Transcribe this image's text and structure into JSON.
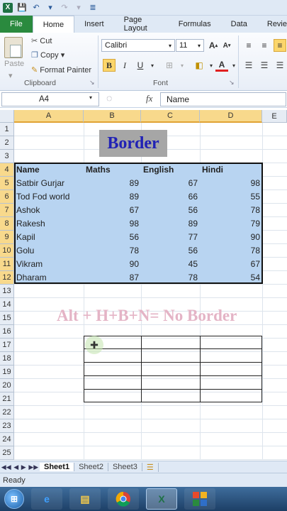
{
  "ribbon_tabs": [
    "File",
    "Home",
    "Insert",
    "Page Layout",
    "Formulas",
    "Data",
    "Revie"
  ],
  "clipboard": {
    "cut": "Cut",
    "copy": "Copy",
    "format_painter": "Format Painter",
    "paste": "Paste",
    "label": "Clipboard"
  },
  "font": {
    "name": "Calibri",
    "size": "11",
    "label": "Font"
  },
  "name_box": "A4",
  "fx_label": "fx",
  "formula_value": "Name",
  "columns": [
    "A",
    "B",
    "C",
    "D",
    "E"
  ],
  "rows": [
    "1",
    "2",
    "3",
    "4",
    "5",
    "6",
    "7",
    "8",
    "9",
    "10",
    "11",
    "12",
    "13",
    "14",
    "15",
    "16",
    "17",
    "18",
    "19",
    "20",
    "21",
    "22",
    "23",
    "24",
    "25"
  ],
  "title_text": "Border",
  "table": {
    "headers": [
      "Name",
      "Maths",
      "English",
      "Hindi"
    ],
    "rows": [
      [
        "Satbir Gurjar",
        "89",
        "67",
        "98"
      ],
      [
        "Tod Fod world",
        "89",
        "66",
        "55"
      ],
      [
        "Ashok",
        "67",
        "56",
        "78"
      ],
      [
        "Rakesh",
        "98",
        "89",
        "79"
      ],
      [
        "Kapil",
        "56",
        "77",
        "90"
      ],
      [
        "Golu",
        "78",
        "56",
        "78"
      ],
      [
        "Vikram",
        "90",
        "45",
        "67"
      ],
      [
        "Dharam",
        "87",
        "78",
        "54"
      ]
    ]
  },
  "caption": "Alt + H+B+N= No Border",
  "sheet_tabs": [
    "Sheet1",
    "Sheet2",
    "Sheet3"
  ],
  "status": "Ready",
  "colors": {
    "selection_fill": "#b8d4f1",
    "title_text": "#2122b5",
    "caption": "#e4b4c6",
    "header_selected": "#f8d98c",
    "file_tab": "#2a8a3e"
  }
}
